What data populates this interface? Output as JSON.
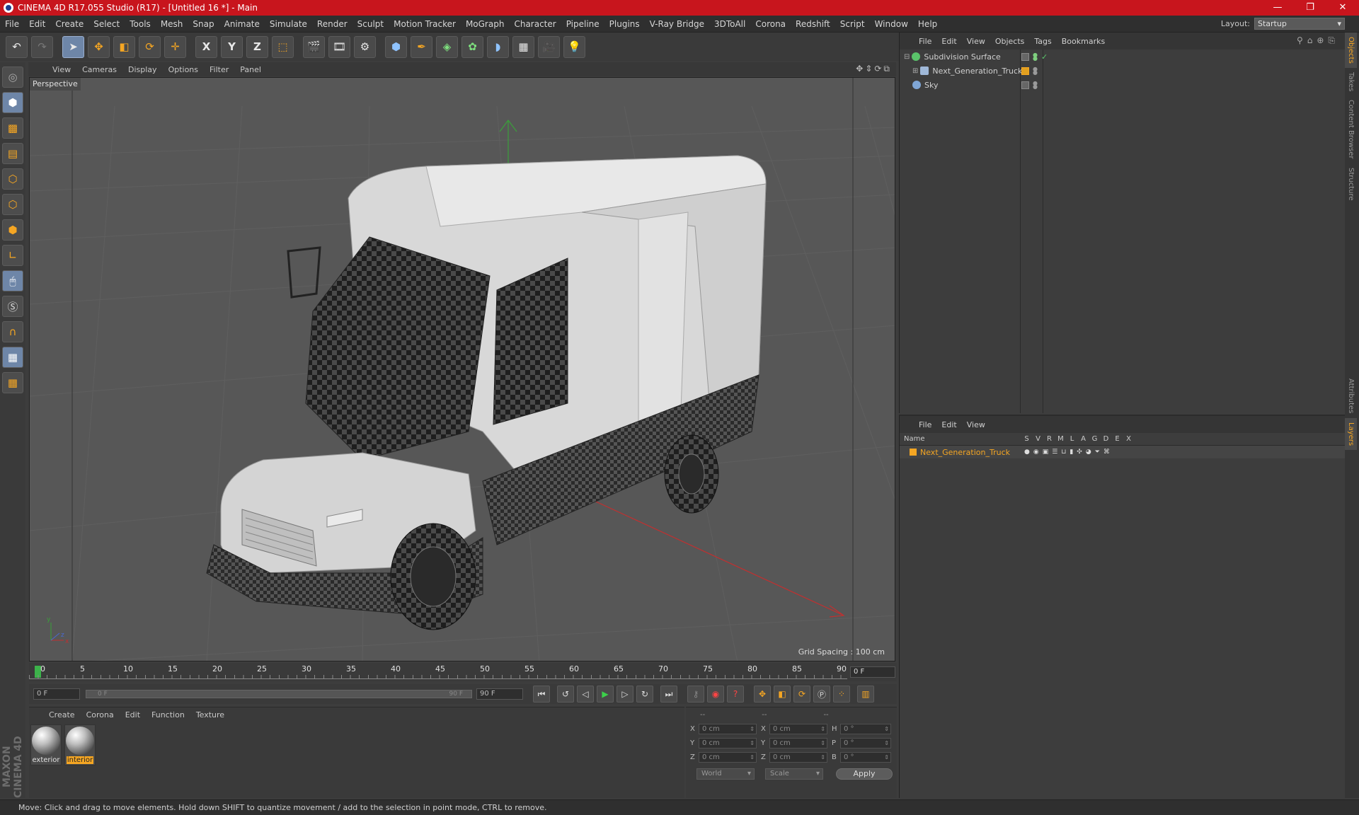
{
  "window": {
    "title": "CINEMA 4D R17.055 Studio (R17) - [Untitled 16 *] - Main",
    "controls": [
      "—",
      "❐",
      "✕"
    ]
  },
  "menubar": {
    "items": [
      "File",
      "Edit",
      "Create",
      "Select",
      "Tools",
      "Mesh",
      "Snap",
      "Animate",
      "Simulate",
      "Render",
      "Sculpt",
      "Motion Tracker",
      "MoGraph",
      "Character",
      "Pipeline",
      "Plugins",
      "V-Ray Bridge",
      "3DToAll",
      "Corona",
      "Redshift",
      "Script",
      "Window",
      "Help"
    ],
    "layout_label": "Layout:",
    "layout_value": "Startup"
  },
  "toolbar": {
    "axis_x": "X",
    "axis_y": "Y",
    "axis_z": "Z"
  },
  "viewport": {
    "menu": [
      "View",
      "Cameras",
      "Display",
      "Options",
      "Filter",
      "Panel"
    ],
    "camera_label": "Perspective",
    "grid_spacing": "Grid Spacing : 100 cm"
  },
  "timeline": {
    "ticks": [
      "0",
      "5",
      "10",
      "15",
      "20",
      "25",
      "30",
      "35",
      "40",
      "45",
      "50",
      "55",
      "60",
      "65",
      "70",
      "75",
      "80",
      "85",
      "90"
    ],
    "current_frame": "0 F"
  },
  "transport": {
    "start_field": "0 F",
    "range_start": "0 F",
    "range_end": "90 F",
    "end_field": "90 F"
  },
  "materials": {
    "menu": [
      "Create",
      "Corona",
      "Edit",
      "Function",
      "Texture"
    ],
    "items": [
      {
        "label": "exterior",
        "selected": false
      },
      {
        "label": "interior",
        "selected": true
      }
    ]
  },
  "coordinates": {
    "headers": [
      "--",
      "--",
      "--"
    ],
    "rows": [
      {
        "l1": "X",
        "v1": "0 cm",
        "l2": "X",
        "v2": "0 cm",
        "l3": "H",
        "v3": "0 °"
      },
      {
        "l1": "Y",
        "v1": "0 cm",
        "l2": "Y",
        "v2": "0 cm",
        "l3": "P",
        "v3": "0 °"
      },
      {
        "l1": "Z",
        "v1": "0 cm",
        "l2": "Z",
        "v2": "0 cm",
        "l3": "B",
        "v3": "0 °"
      }
    ],
    "coord_system": "World",
    "mode": "Scale",
    "apply_label": "Apply"
  },
  "object_manager": {
    "menu": [
      "File",
      "Edit",
      "View",
      "Objects",
      "Tags",
      "Bookmarks"
    ],
    "objects": [
      {
        "name": "Subdivision Surface",
        "icon_color": "#5ac46a",
        "indent": 0,
        "expander": "⊟"
      },
      {
        "name": "Next_Generation_Truck",
        "icon_color": "#9fb8d8",
        "indent": 1,
        "expander": "⊞"
      },
      {
        "name": "Sky",
        "icon_color": "#7fa6d6",
        "indent": 0,
        "expander": ""
      }
    ]
  },
  "layer_manager": {
    "menu": [
      "File",
      "Edit",
      "View"
    ],
    "name_header": "Name",
    "columns": [
      "S",
      "V",
      "R",
      "M",
      "L",
      "A",
      "G",
      "D",
      "E",
      "X"
    ],
    "layers": [
      {
        "name": "Next_Generation_Truck",
        "color": "#f5a623"
      }
    ]
  },
  "side_tabs": [
    "Objects",
    "Takes",
    "Content Browser",
    "Structure",
    "Attributes",
    "Layers"
  ],
  "status": {
    "text": "Move: Click and drag to move elements. Hold down SHIFT to quantize movement / add to the selection in point mode, CTRL to remove."
  },
  "colors": {
    "titlebar": "#c8151d",
    "accent_orange": "#f5a623",
    "selection_blue": "#6e86a8"
  }
}
